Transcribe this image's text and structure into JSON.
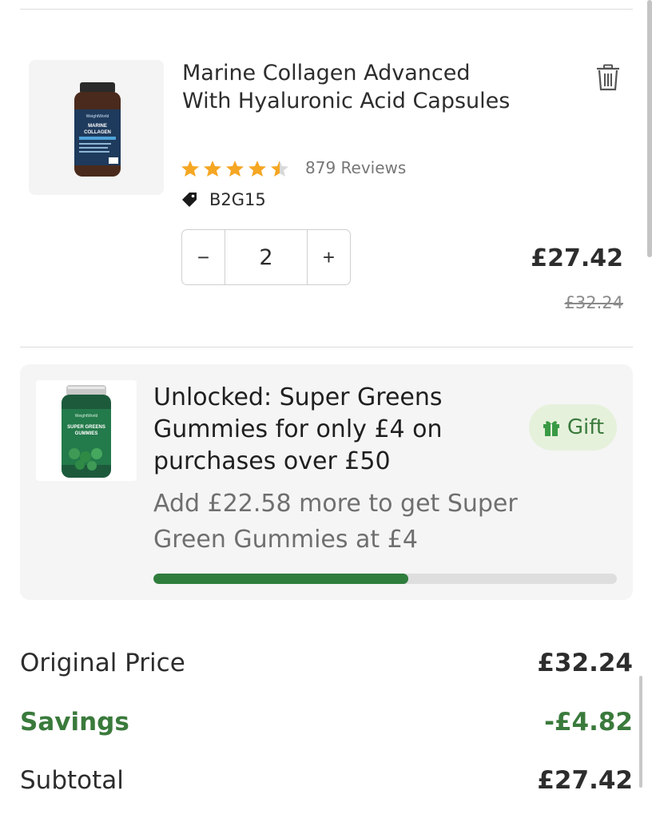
{
  "cart_item": {
    "title": "Marine Collagen Advanced With Hyaluronic Acid Capsules",
    "rating": 4.5,
    "reviews": "879 Reviews",
    "tag_icon": "tag-icon",
    "promo_tag": "B2G15",
    "quantity": "2",
    "decrement_label": "−",
    "increment_label": "+",
    "price": "£27.42",
    "original_price": "£32.24",
    "thumb_label_brand": "WeightWorld",
    "thumb_label_name": "MARINE COLLAGEN"
  },
  "gift_offer": {
    "title": "Unlocked: Super Greens Gummies for only £4 on purchases over £50",
    "badge_label": "Gift",
    "badge_icon": "gift-icon",
    "message": "Add £22.58 more to get Super Green Gummies at £4",
    "progress": 0.55,
    "thumb_label_brand": "WeightWorld",
    "thumb_label_name": "SUPER GREENS GUMMIES"
  },
  "summary": {
    "original_price_label": "Original Price",
    "original_price_value": "£32.24",
    "savings_label": "Savings",
    "savings_value": "-£4.82",
    "subtotal_label": "Subtotal",
    "subtotal_value": "£27.42"
  },
  "colors": {
    "accent_green": "#2f7d3c",
    "star": "#f5a623",
    "panel_bg": "#f5f5f5"
  }
}
